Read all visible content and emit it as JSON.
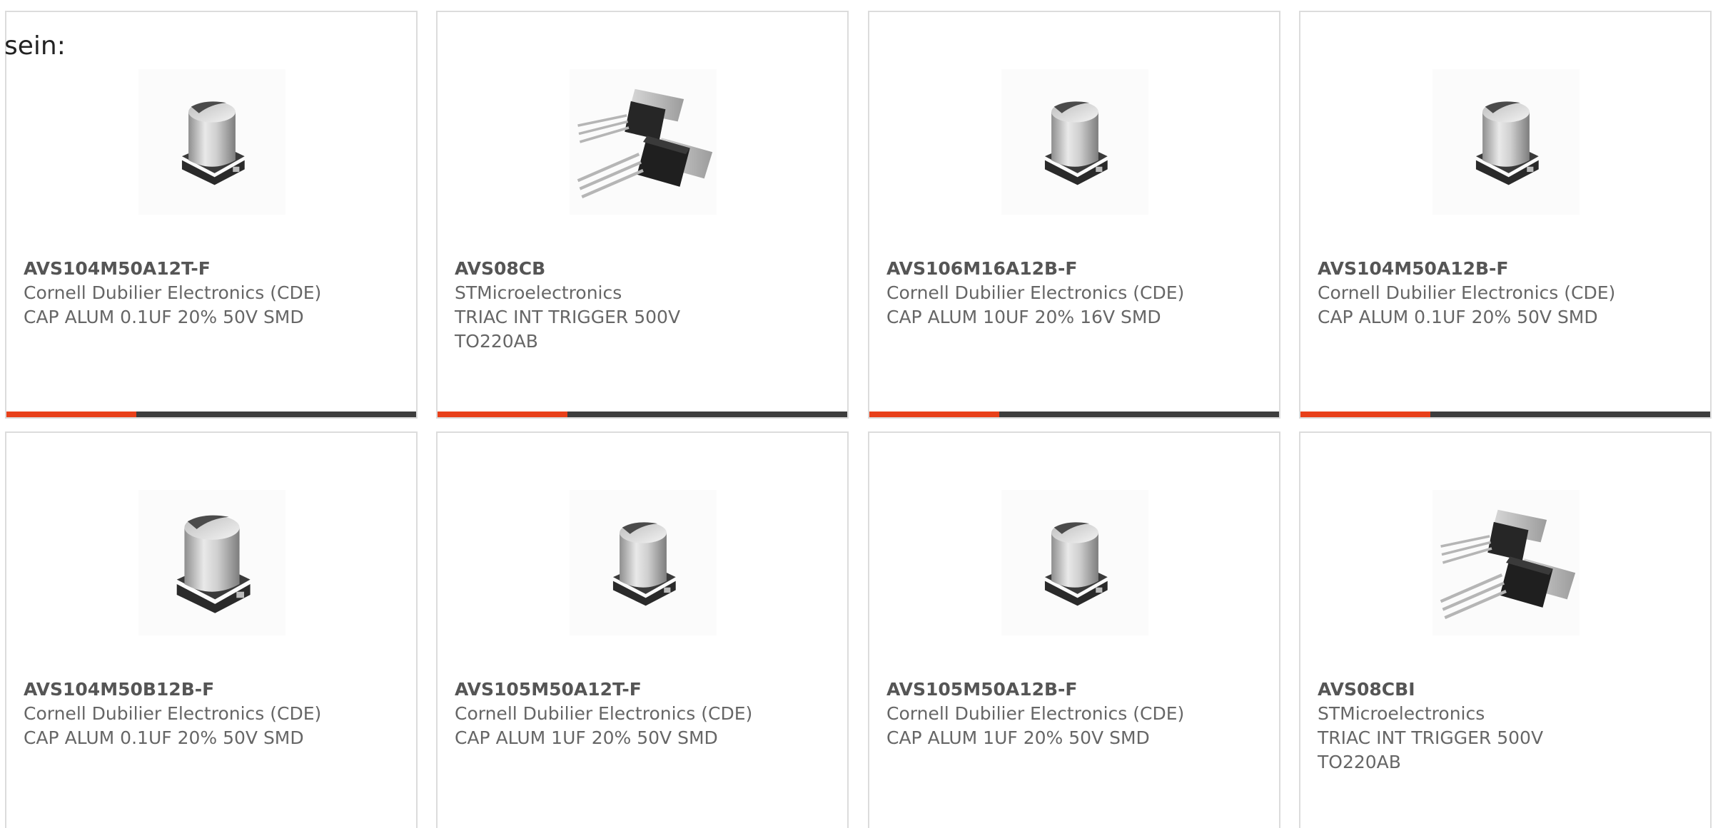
{
  "intro_text": "sein:",
  "accent_color": "#e8401a",
  "bar_color": "#3d3d3d",
  "products": [
    {
      "part": "AVS104M50A12T-F",
      "manufacturer": "Cornell Dubilier Electronics (CDE)",
      "description": "CAP ALUM 0.1UF 20% 50V SMD",
      "image_icon": "smd-capacitor-icon"
    },
    {
      "part": "AVS08CB",
      "manufacturer": "STMicroelectronics",
      "description": "TRIAC INT TRIGGER 500V TO220AB",
      "image_icon": "to220-package-icon"
    },
    {
      "part": "AVS106M16A12B-F",
      "manufacturer": "Cornell Dubilier Electronics (CDE)",
      "description": "CAP ALUM 10UF 20% 16V SMD",
      "image_icon": "smd-capacitor-icon"
    },
    {
      "part": "AVS104M50A12B-F",
      "manufacturer": "Cornell Dubilier Electronics (CDE)",
      "description": "CAP ALUM 0.1UF 20% 50V SMD",
      "image_icon": "smd-capacitor-icon"
    },
    {
      "part": "AVS104M50B12B-F",
      "manufacturer": "Cornell Dubilier Electronics (CDE)",
      "description": "CAP ALUM 0.1UF 20% 50V SMD",
      "image_icon": "smd-capacitor-icon"
    },
    {
      "part": "AVS105M50A12T-F",
      "manufacturer": "Cornell Dubilier Electronics (CDE)",
      "description": "CAP ALUM 1UF 20% 50V SMD",
      "image_icon": "smd-capacitor-icon"
    },
    {
      "part": "AVS105M50A12B-F",
      "manufacturer": "Cornell Dubilier Electronics (CDE)",
      "description": "CAP ALUM 1UF 20% 50V SMD",
      "image_icon": "smd-capacitor-icon"
    },
    {
      "part": "AVS08CBI",
      "manufacturer": "STMicroelectronics",
      "description": "TRIAC INT TRIGGER 500V TO220AB",
      "image_icon": "to220-package-icon"
    }
  ]
}
